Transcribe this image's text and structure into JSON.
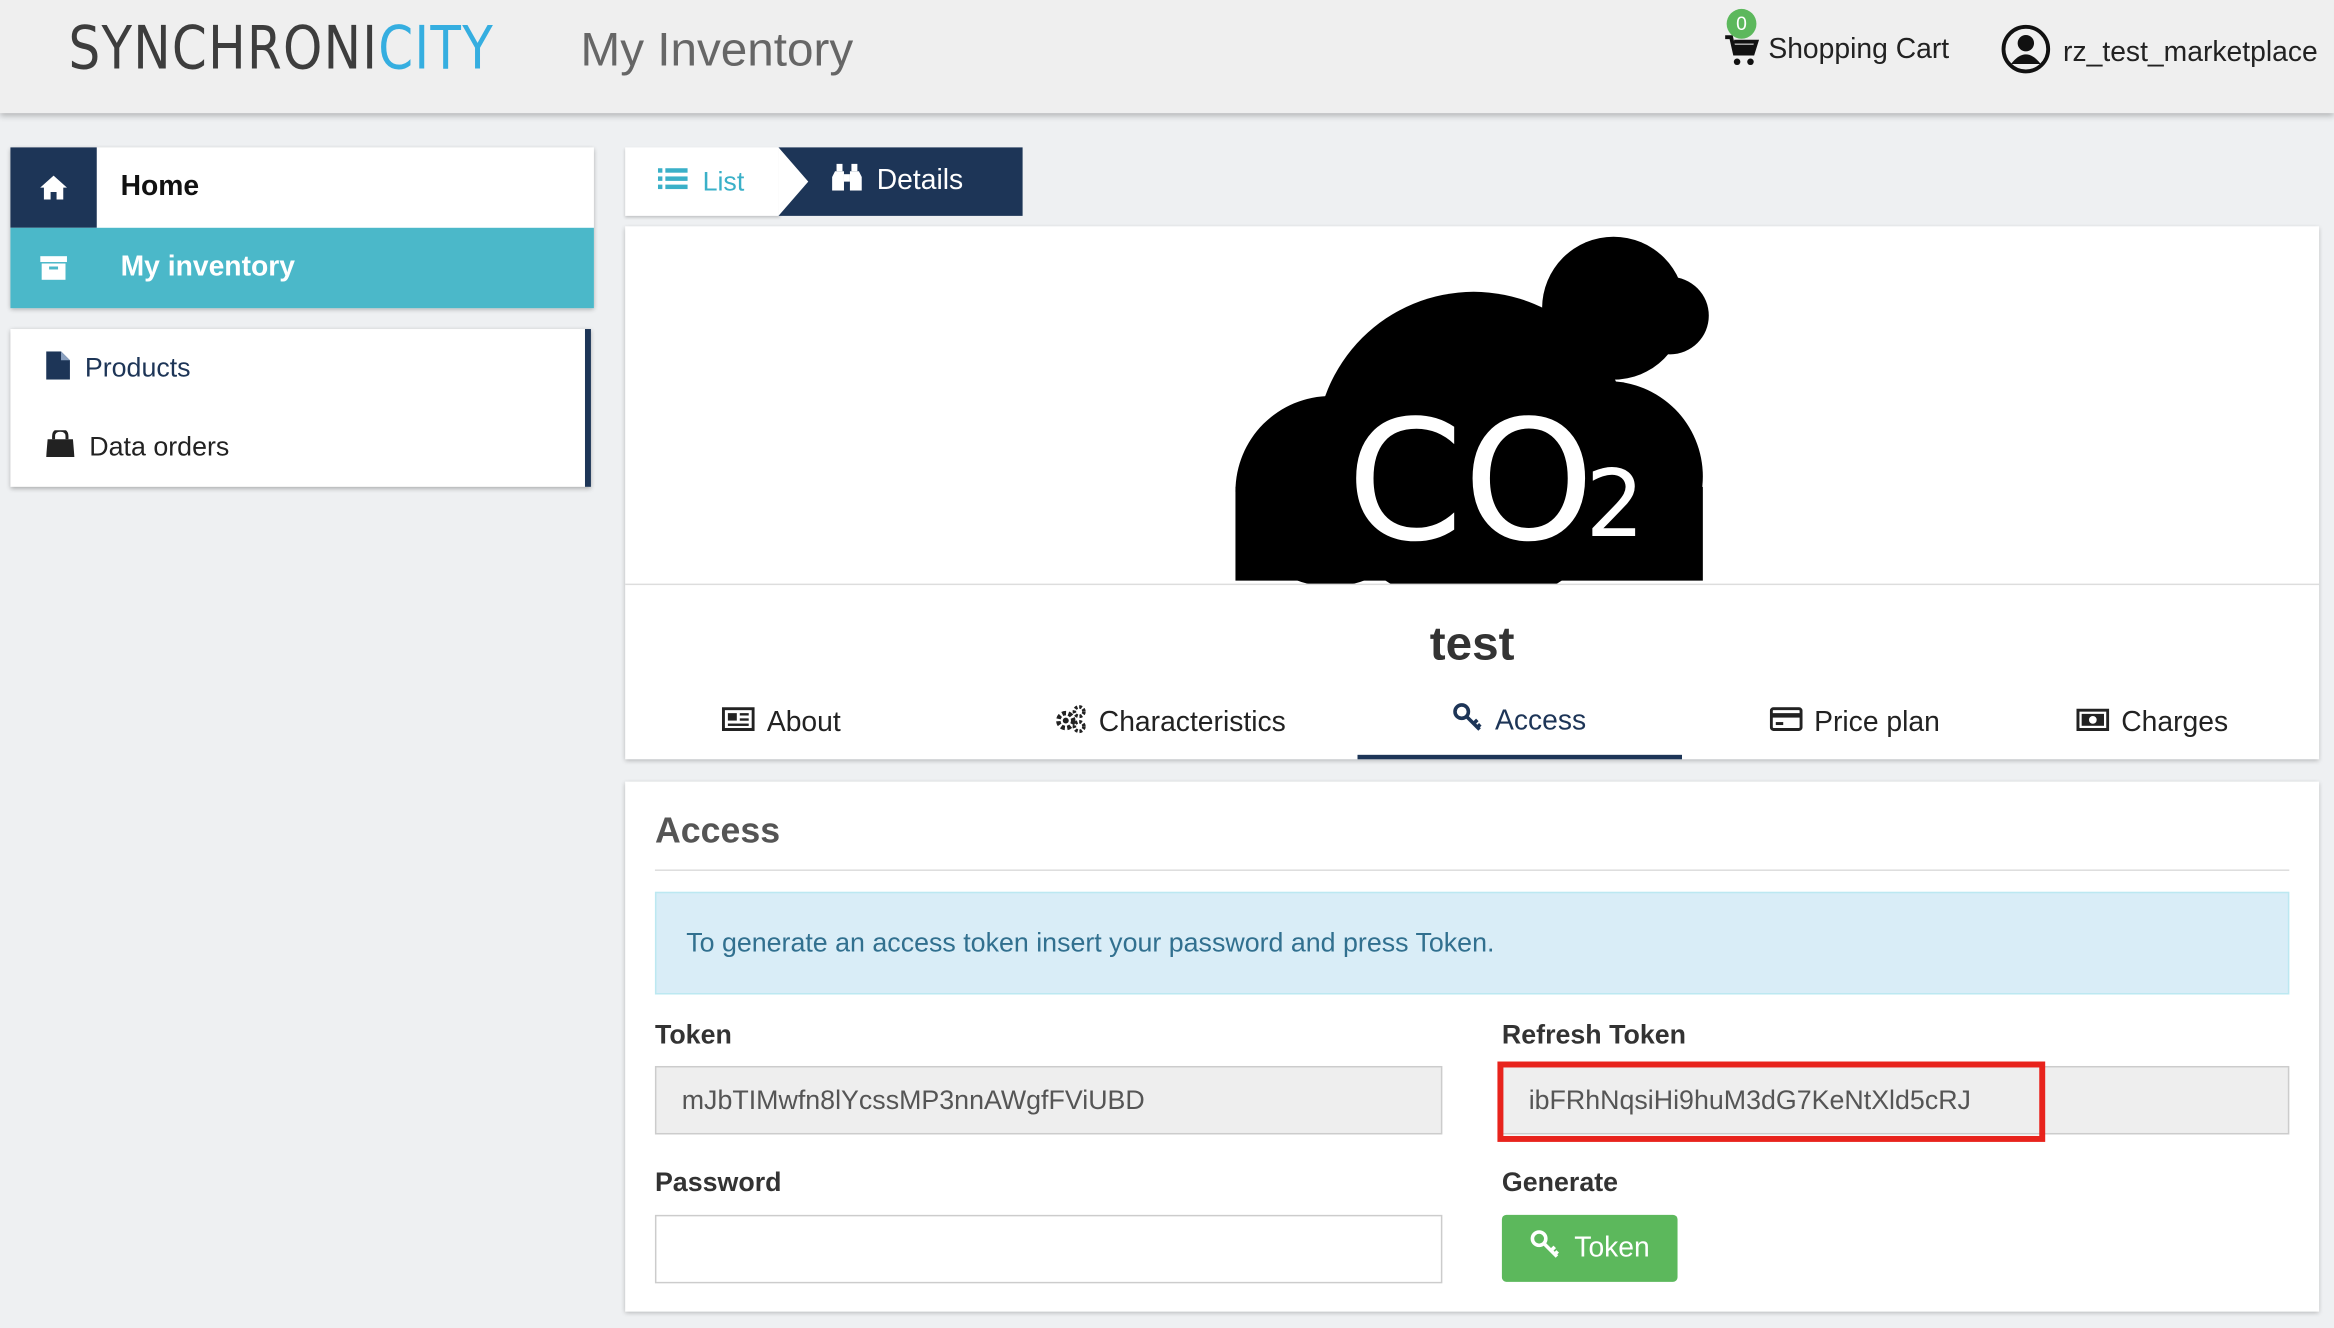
{
  "header": {
    "logo_part1": "SYNCHRONI",
    "logo_part2": "CITY",
    "app_title": "My Inventory",
    "cart_count": "0",
    "cart_label": "Shopping Cart",
    "username": "rz_test_marketplace"
  },
  "sidebar": {
    "main": [
      {
        "label": "Home",
        "icon": "home-icon"
      },
      {
        "label": "My inventory",
        "icon": "archive-icon"
      }
    ],
    "sub": [
      {
        "label": "Products",
        "icon": "file-icon"
      },
      {
        "label": "Data orders",
        "icon": "shopping-bag-icon"
      }
    ]
  },
  "breadcrumb": {
    "list_label": "List",
    "details_label": "Details"
  },
  "product": {
    "name": "test",
    "image_text": "CO",
    "image_subscript": "2",
    "tabs": [
      {
        "label": "About",
        "icon": "newspaper-icon"
      },
      {
        "label": "Characteristics",
        "icon": "gears-icon"
      },
      {
        "label": "Access",
        "icon": "key-icon",
        "active": true
      },
      {
        "label": "Price plan",
        "icon": "credit-card-icon"
      },
      {
        "label": "Charges",
        "icon": "money-icon"
      }
    ]
  },
  "access": {
    "title": "Access",
    "info": "To generate an access token insert your password and press Token.",
    "token_label": "Token",
    "token_value": "mJbTIMwfn8lYcssMP3nnAWgfFViUBD",
    "refresh_label": "Refresh Token",
    "refresh_value": "ibFRhNqsiHi9huM3dG7KeNtXld5cRJ",
    "password_label": "Password",
    "password_value": "",
    "generate_label": "Generate",
    "token_button": "Token"
  },
  "colors": {
    "navy": "#1d3557",
    "teal": "#4bb8c9",
    "green": "#5cb85c",
    "highlight": "#e8231c"
  }
}
